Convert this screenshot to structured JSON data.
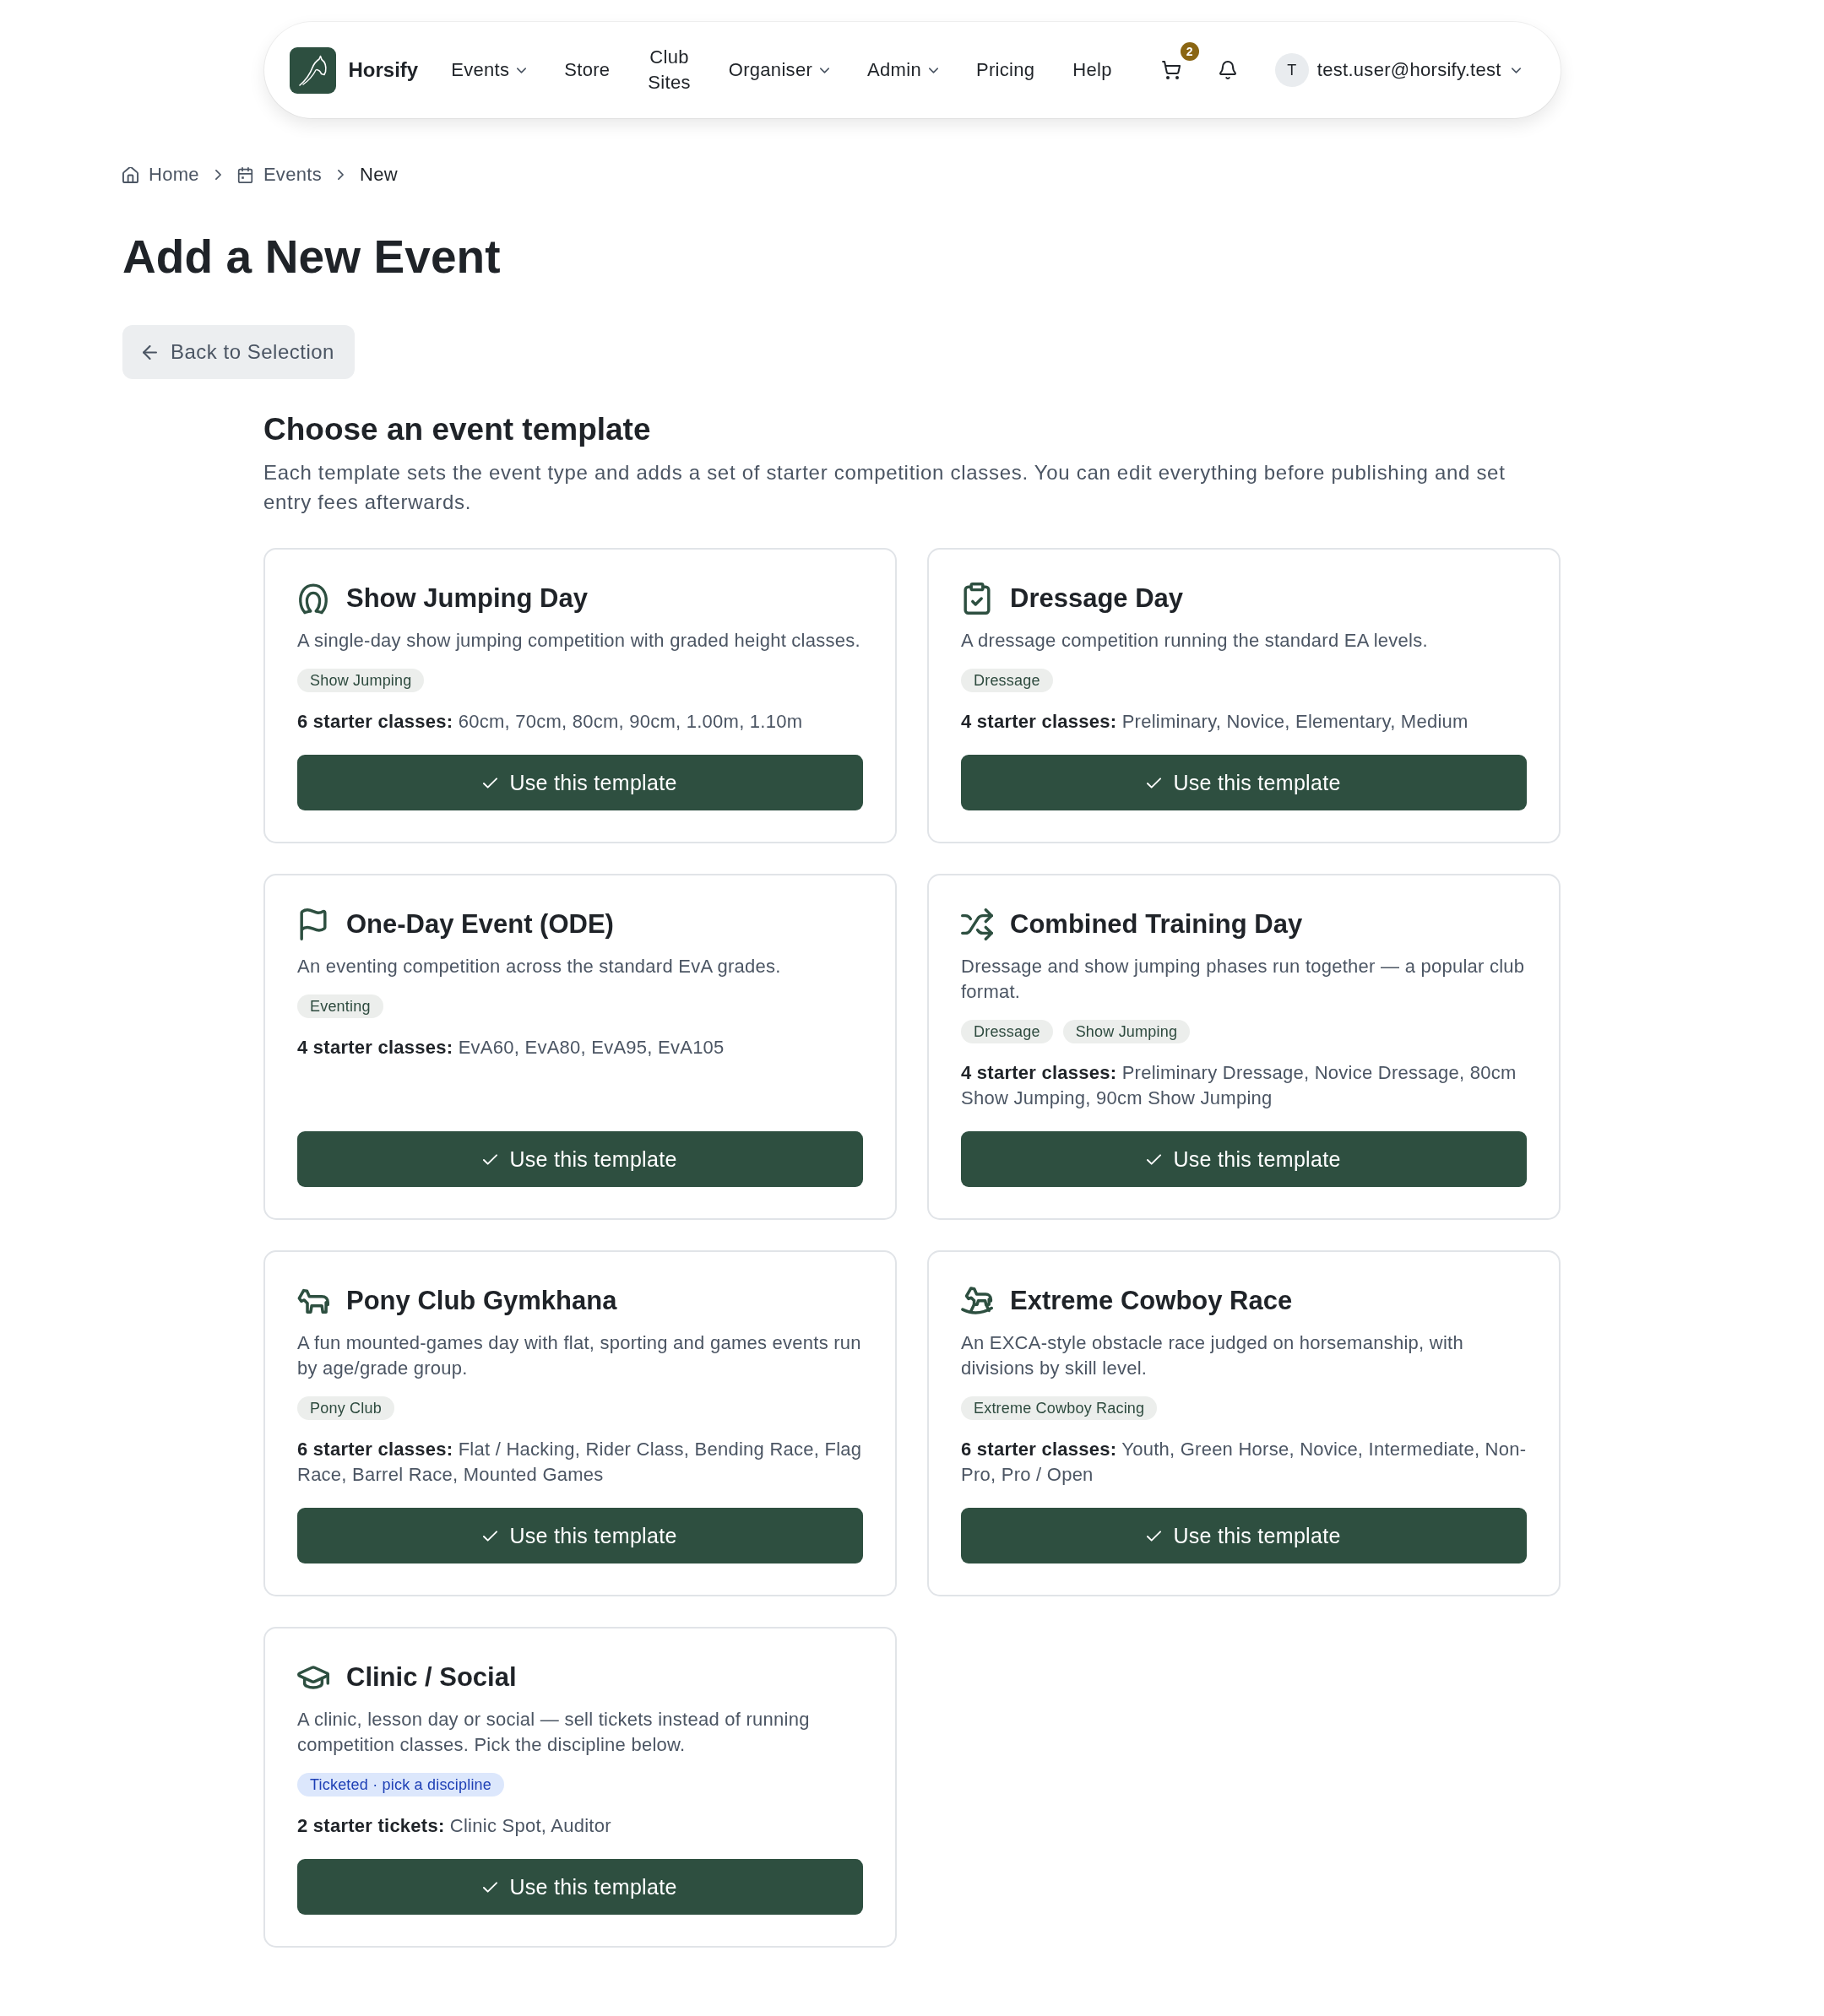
{
  "navbar": {
    "brand": "Horsify",
    "items": [
      {
        "label": "Events",
        "dropdown": true
      },
      {
        "label": "Store",
        "dropdown": false
      },
      {
        "label": "Club Sites",
        "dropdown": false
      },
      {
        "label": "Organiser",
        "dropdown": true
      },
      {
        "label": "Admin",
        "dropdown": true
      },
      {
        "label": "Pricing",
        "dropdown": false
      },
      {
        "label": "Help",
        "dropdown": false
      }
    ],
    "cart_count": "2",
    "user": {
      "initial": "T",
      "email": "test.user@horsify.test"
    }
  },
  "breadcrumb": [
    {
      "label": "Home",
      "kind": "home",
      "current": false
    },
    {
      "label": "Events",
      "kind": "calendar",
      "current": false
    },
    {
      "label": "New",
      "kind": "page",
      "current": true
    }
  ],
  "title": "Add a New Event",
  "back_button": "Back to Selection",
  "section": {
    "heading": "Choose an event template",
    "description": "Each template sets the event type and adds a set of starter competition classes. You can edit everything before publishing and set entry fees afterwards."
  },
  "templates": [
    {
      "kind": "jumping",
      "title": "Show Jumping Day",
      "description": "A single-day show jumping competition with graded height classes.",
      "tags": [
        {
          "label": "Show Jumping",
          "kind": "discipline"
        }
      ],
      "classes": "**6 starter classes:** 60cm, 70cm, 80cm, 90cm, 1.00m, 1.10m",
      "button": "Use this template"
    },
    {
      "kind": "dressage",
      "title": "Dressage Day",
      "description": "A dressage competition running the standard EA levels.",
      "tags": [
        {
          "label": "Dressage",
          "kind": "discipline"
        }
      ],
      "classes": "**4 starter classes:** Preliminary, Novice, Elementary, Medium",
      "button": "Use this template"
    },
    {
      "kind": "eventing",
      "title": "One-Day Event (ODE)",
      "description": "An eventing competition across the standard EvA grades.",
      "tags": [
        {
          "label": "Eventing",
          "kind": "discipline"
        }
      ],
      "classes": "**4 starter classes:** EvA60, EvA80, EvA95, EvA105",
      "button": "Use this template"
    },
    {
      "kind": "combined",
      "title": "Combined Training Day",
      "description": "Dressage and show jumping phases run together — a popular club format.",
      "tags": [
        {
          "label": "Dressage",
          "kind": "discipline"
        },
        {
          "label": "Show Jumping",
          "kind": "discipline"
        }
      ],
      "classes": "**4 starter classes:** Preliminary Dressage, Novice Dressage, 80cm Show Jumping, 90cm Show Jumping",
      "button": "Use this template"
    },
    {
      "kind": "gymkhana",
      "title": "Pony Club Gymkhana",
      "description": "A fun mounted-games day with flat, sporting and games events run by age/grade group.",
      "tags": [
        {
          "label": "Pony Club",
          "kind": "discipline"
        }
      ],
      "classes": "**6 starter classes:** Flat / Hacking, Rider Class, Bending Race, Flag Race, Barrel Race, Mounted Games",
      "button": "Use this template"
    },
    {
      "kind": "cowboy",
      "title": "Extreme Cowboy Race",
      "description": "An EXCA-style obstacle race judged on horsemanship, with divisions by skill level.",
      "tags": [
        {
          "label": "Extreme Cowboy Racing",
          "kind": "discipline"
        }
      ],
      "classes": "**6 starter classes:** Youth, Green Horse, Novice, Intermediate, Non-Pro, Pro / Open",
      "button": "Use this template"
    },
    {
      "kind": "clinic",
      "title": "Clinic / Social",
      "description": "A clinic, lesson day or social — sell tickets instead of running competition classes. Pick the discipline below.",
      "tags": [
        {
          "label": "Ticketed · pick a discipline",
          "kind": "ticketed"
        }
      ],
      "classes": "**2 starter tickets:** Clinic Spot, Auditor",
      "button": "Use this template"
    }
  ]
}
